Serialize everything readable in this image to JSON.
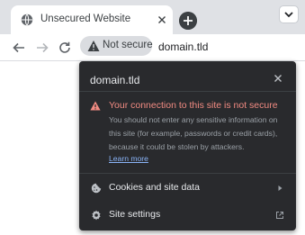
{
  "tab": {
    "title": "Unsecured Website",
    "favicon": "globe-icon",
    "close_icon": "close-icon"
  },
  "tabstrip": {
    "new_tab_icon": "plus-icon",
    "tab_search_icon": "chevron-down-icon"
  },
  "toolbar": {
    "back_icon": "back-arrow-icon",
    "forward_icon": "forward-arrow-icon",
    "reload_icon": "reload-icon",
    "security_chip_label": "Not secure",
    "security_chip_icon": "warning-icon",
    "url": "domain.tld"
  },
  "popup": {
    "title": "domain.tld",
    "close_icon": "close-icon",
    "warning_title": "Your connection to this site is not secure",
    "warning_body": "You should not enter any sensitive information on this site (for example, passwords or credit cards), because it could be stolen by attackers.",
    "learn_more": "Learn more",
    "items": [
      {
        "label": "Cookies and site data",
        "icon": "cookie-icon",
        "trailing_icon": "chevron-right-icon"
      },
      {
        "label": "Site settings",
        "icon": "gear-icon",
        "trailing_icon": "external-link-icon"
      }
    ]
  },
  "colors": {
    "tabstrip_bg": "#dfe1e5",
    "popup_bg": "#292a2d",
    "warning_red": "#f28b82",
    "link_blue": "#8ab4f8",
    "chip_bg": "#dadce0"
  }
}
